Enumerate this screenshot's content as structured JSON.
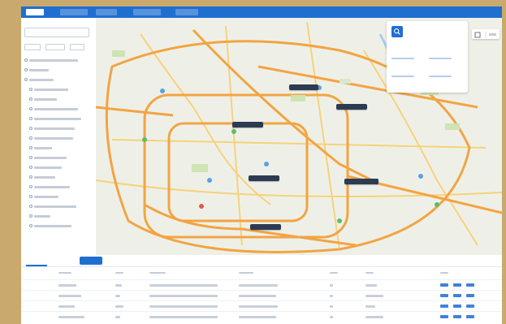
{
  "top_nav": {
    "tabs": [
      {
        "label": "",
        "active": true
      },
      {
        "label": "",
        "active": false
      },
      {
        "label": "",
        "active": false
      },
      {
        "label": "",
        "active": false
      },
      {
        "label": "",
        "active": false
      }
    ]
  },
  "sidebar": {
    "search_placeholder": "",
    "tree_items": [
      "",
      "",
      "",
      "",
      "",
      "",
      "",
      "",
      "",
      "",
      "",
      "",
      "",
      "",
      "",
      "",
      "",
      ""
    ]
  },
  "map": {
    "pins": [
      "",
      "",
      "",
      "",
      "",
      ""
    ]
  },
  "stats_card": {
    "total": "",
    "stats": [
      {
        "value": "",
        "label": ""
      },
      {
        "value": "",
        "label": ""
      },
      {
        "value": "",
        "label": ""
      },
      {
        "value": "",
        "label": ""
      }
    ]
  },
  "bottom_panel": {
    "tabs": [
      {
        "label": "",
        "active": true
      },
      {
        "label": "",
        "active": false
      }
    ],
    "button_label": "",
    "columns": [
      "",
      "",
      "",
      "",
      "",
      "",
      ""
    ],
    "rows": [
      {
        "cells": [
          "",
          "",
          "",
          "",
          "",
          ""
        ]
      },
      {
        "cells": [
          "",
          "",
          "",
          "",
          "",
          ""
        ]
      },
      {
        "cells": [
          "",
          "",
          "",
          "",
          "",
          ""
        ]
      },
      {
        "cells": [
          "",
          "",
          "",
          "",
          "",
          ""
        ]
      }
    ]
  },
  "colors": {
    "brand": "#1f6fd1",
    "frame_background": "#c9a96e",
    "map_road_major": "#f3a442",
    "map_road_minor": "#f7d27a",
    "map_park": "#cfe3b4",
    "map_water": "#a9cdf0",
    "pin_background": "#2d3b52"
  }
}
